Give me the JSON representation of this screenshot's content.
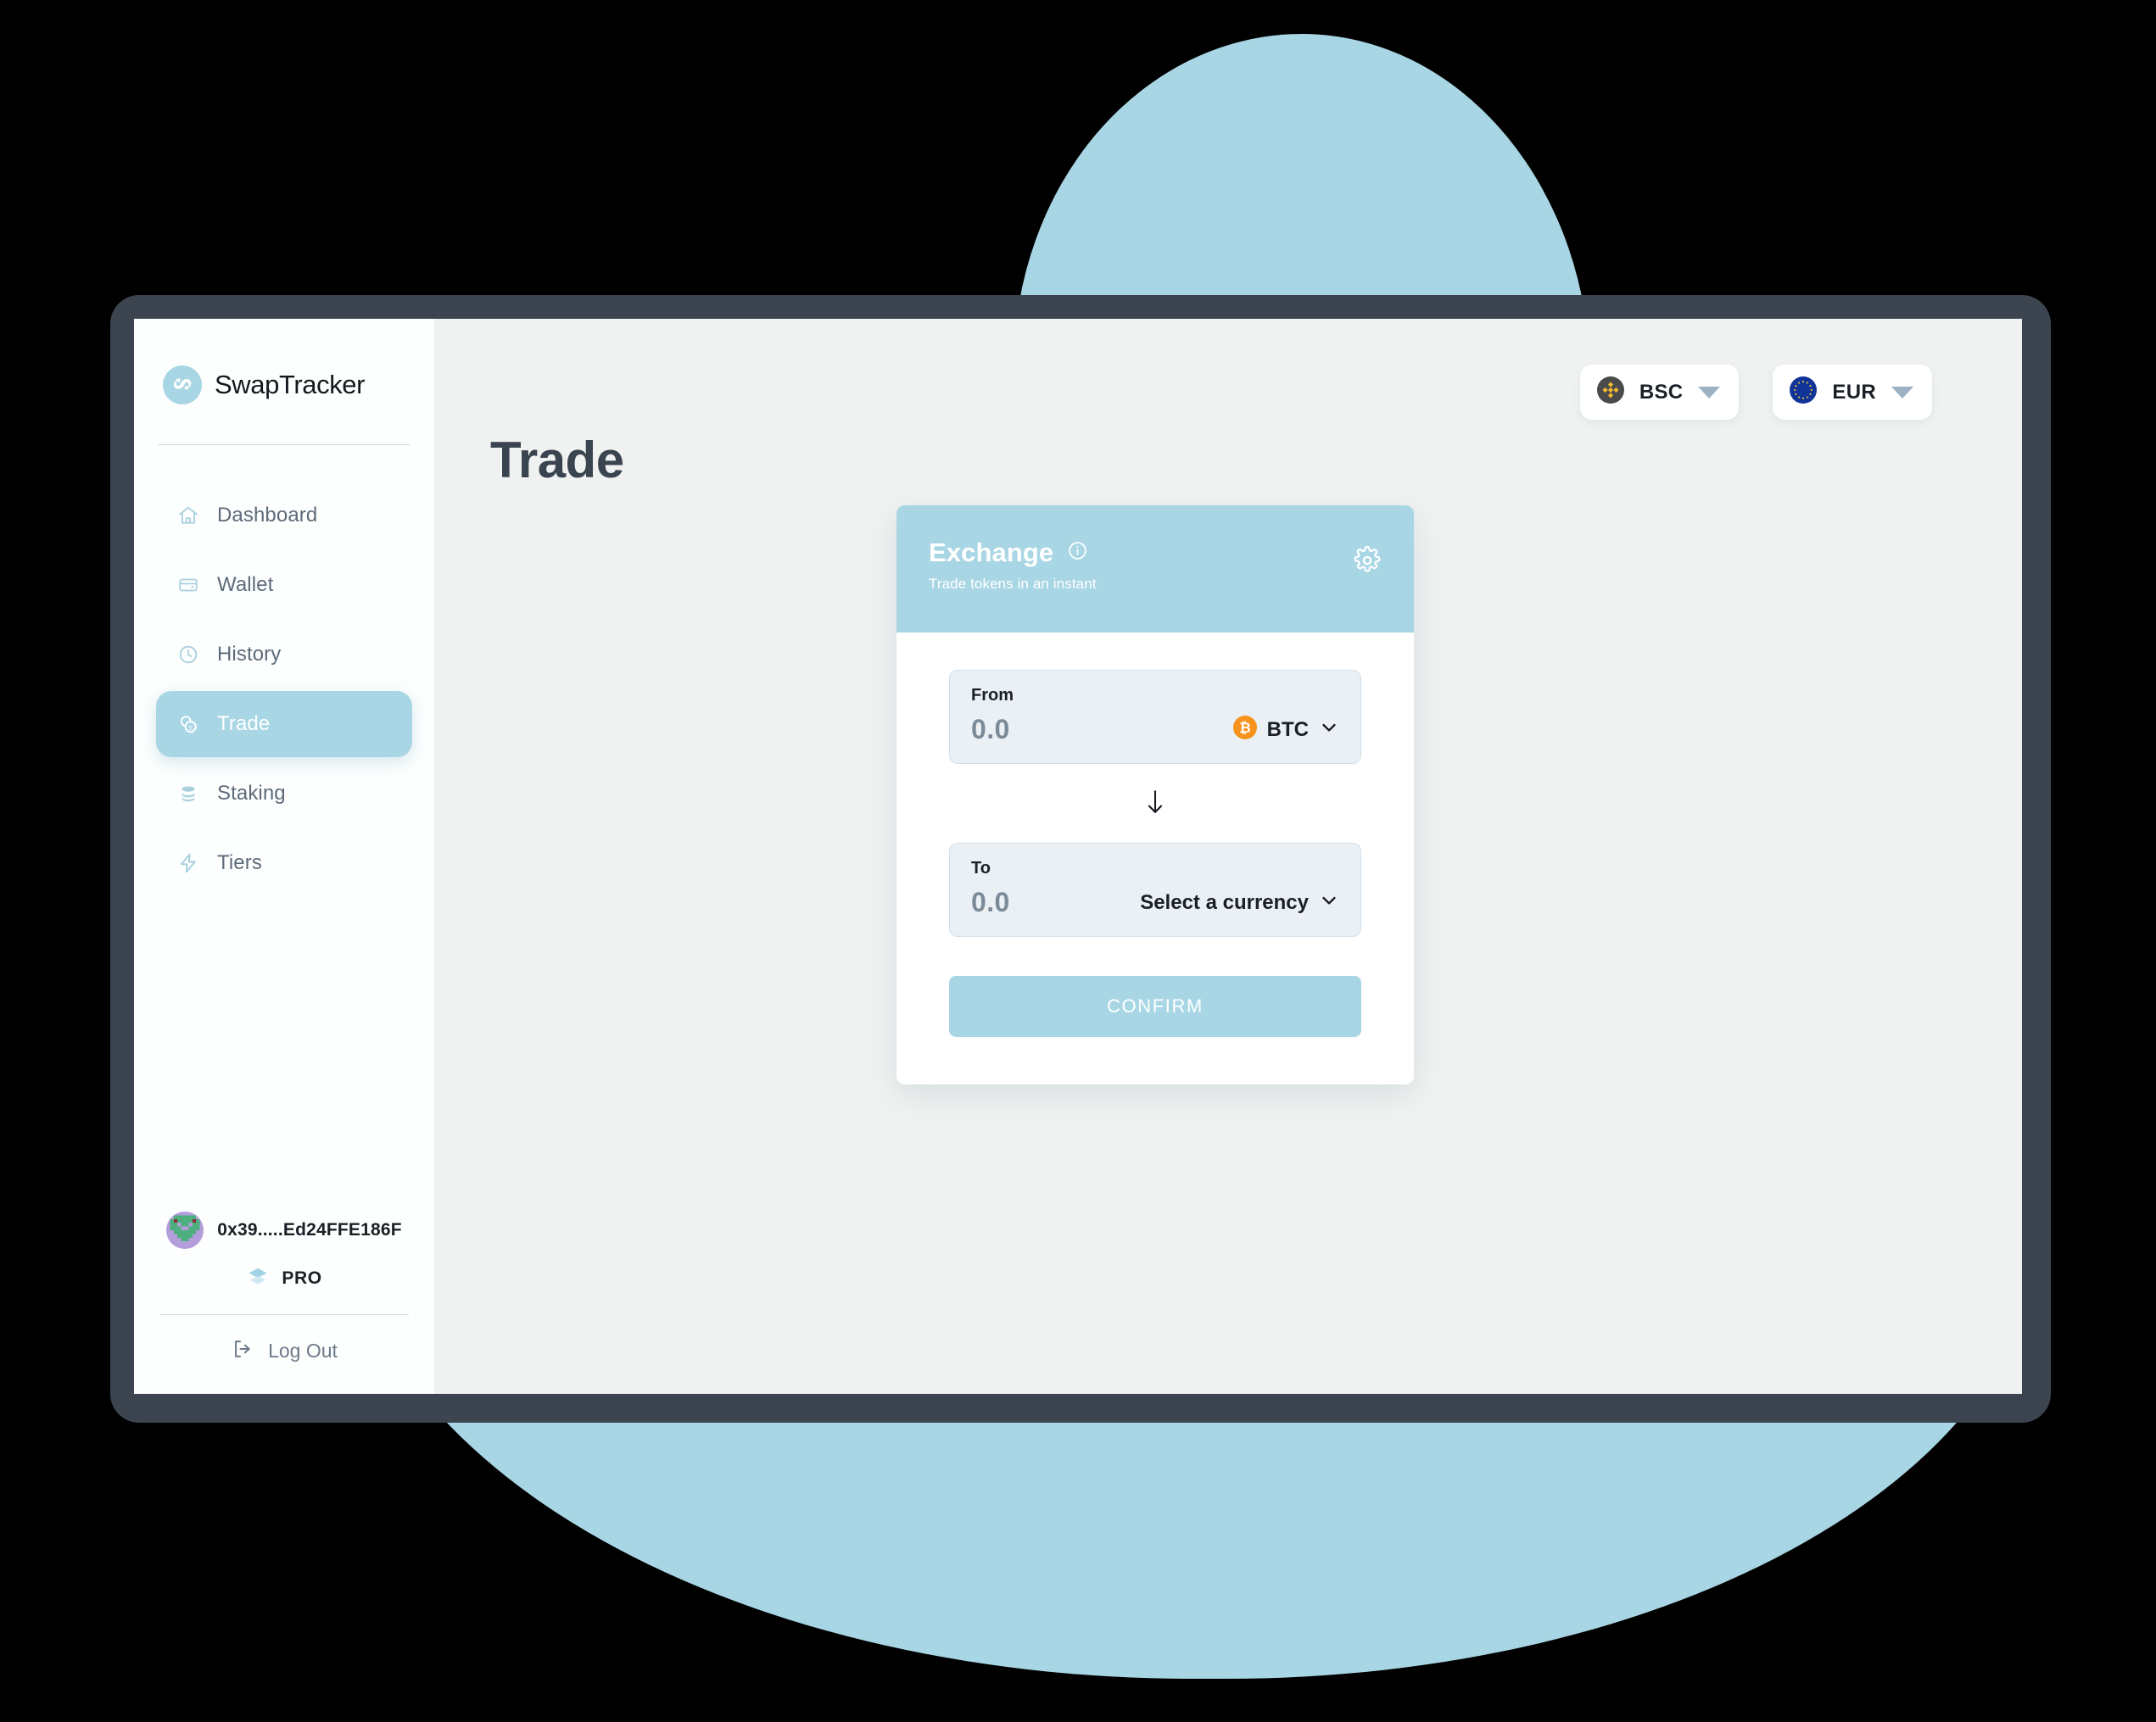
{
  "brand": {
    "name": "SwapTracker",
    "logo_icon": "swaptracker-s-logo"
  },
  "sidebar": {
    "items": [
      {
        "label": "Dashboard",
        "icon": "home-icon",
        "active": false
      },
      {
        "label": "Wallet",
        "icon": "wallet-icon",
        "active": false
      },
      {
        "label": "History",
        "icon": "clock-icon",
        "active": false
      },
      {
        "label": "Trade",
        "icon": "coins-icon",
        "active": true
      },
      {
        "label": "Staking",
        "icon": "stack-coins-icon",
        "active": false
      },
      {
        "label": "Tiers",
        "icon": "lightning-bolt-icon",
        "active": false
      }
    ],
    "user": {
      "address": "0x39.....Ed24FFE186F",
      "avatar_icon": "identicon-avatar",
      "tier_label": "PRO",
      "tier_icon": "layers-diamond-icon"
    },
    "logout": {
      "label": "Log Out",
      "icon": "logout-icon"
    }
  },
  "topbar": {
    "network": {
      "label": "BSC",
      "icon": "binance-smart-chain-icon",
      "caret": "chevron-down-icon"
    },
    "currency": {
      "label": "EUR",
      "icon": "euro-flag-icon",
      "caret": "chevron-down-icon"
    }
  },
  "main": {
    "page_title": "Trade"
  },
  "exchange_card": {
    "title": "Exchange",
    "info_icon": "info-icon",
    "subtitle": "Trade tokens in an instant",
    "settings_icon": "gear-icon",
    "from": {
      "label": "From",
      "value": "0.0",
      "placeholder": "0.0",
      "token_label": "BTC",
      "token_icon": "bitcoin-icon",
      "caret": "chevron-down-icon"
    },
    "swap_icon": "arrow-down-icon",
    "to": {
      "label": "To",
      "value": "0.0",
      "placeholder": "0.0",
      "token_label": "Select a currency",
      "caret": "chevron-down-icon"
    },
    "confirm_label": "CONFIRM"
  },
  "colors": {
    "accent": "#a9d6e4",
    "bezel": "#3c4450",
    "screen_bg": "#eff2f1",
    "sidebar_bg": "#fdfefe",
    "field_bg": "#eaf0f4",
    "title": "#3a4450",
    "muted_text": "#5d6b7a",
    "bitcoin_orange": "#f7931a",
    "binance_yellow": "#f3ba2f",
    "eu_blue": "#123398"
  }
}
